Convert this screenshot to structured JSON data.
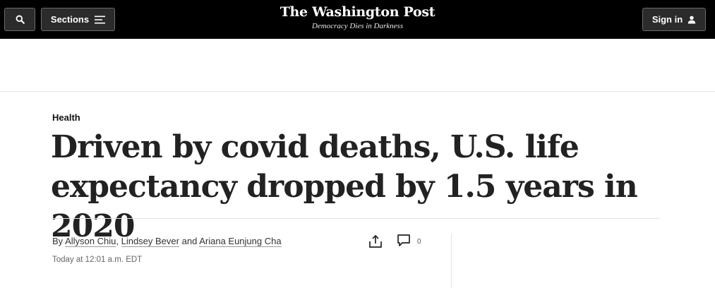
{
  "header": {
    "search_icon": "search-icon",
    "sections_label": "Sections",
    "sections_icon": "menu-icon",
    "logo_text": "The Washington Post",
    "tagline": "Democracy Dies in Darkness",
    "signin_label": "Sign in",
    "signin_icon": "user-icon",
    "background": "#000000"
  },
  "article": {
    "kicker": "Health",
    "headline": "Driven by covid deaths, U.S. life expectancy dropped by 1.5 years in 2020",
    "byline": {
      "prefix": "By",
      "authors": [
        "Allyson Chiu",
        "Lindsey Bever",
        "Ariana Eunjung Cha"
      ],
      "separator": ",",
      "conjunction": "and"
    },
    "timestamp": "Today at 12:01 a.m. EDT",
    "share_icon": "share-icon",
    "comment_icon": "comment-icon",
    "comment_count": "0"
  }
}
